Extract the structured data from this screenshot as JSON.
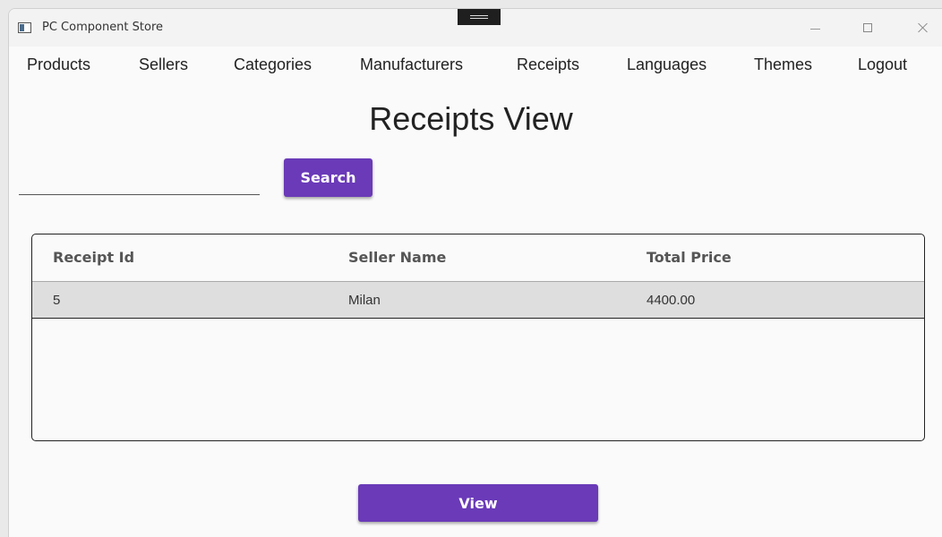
{
  "window": {
    "title": "PC Component Store"
  },
  "nav": {
    "items": [
      {
        "label": "Products"
      },
      {
        "label": "Sellers"
      },
      {
        "label": "Categories"
      },
      {
        "label": "Manufacturers"
      },
      {
        "label": "Receipts"
      },
      {
        "label": "Languages"
      },
      {
        "label": "Themes"
      },
      {
        "label": "Logout"
      }
    ]
  },
  "page": {
    "title": "Receipts View"
  },
  "search": {
    "value": "",
    "button_label": "Search"
  },
  "table": {
    "columns": [
      "Receipt Id",
      "Seller Name",
      "Total Price"
    ],
    "rows": [
      [
        "5",
        "Milan",
        "4400.00"
      ]
    ]
  },
  "actions": {
    "view_label": "View"
  },
  "colors": {
    "accent": "#6a3ab8",
    "background": "#fafafa",
    "selected_row": "#dedede"
  }
}
